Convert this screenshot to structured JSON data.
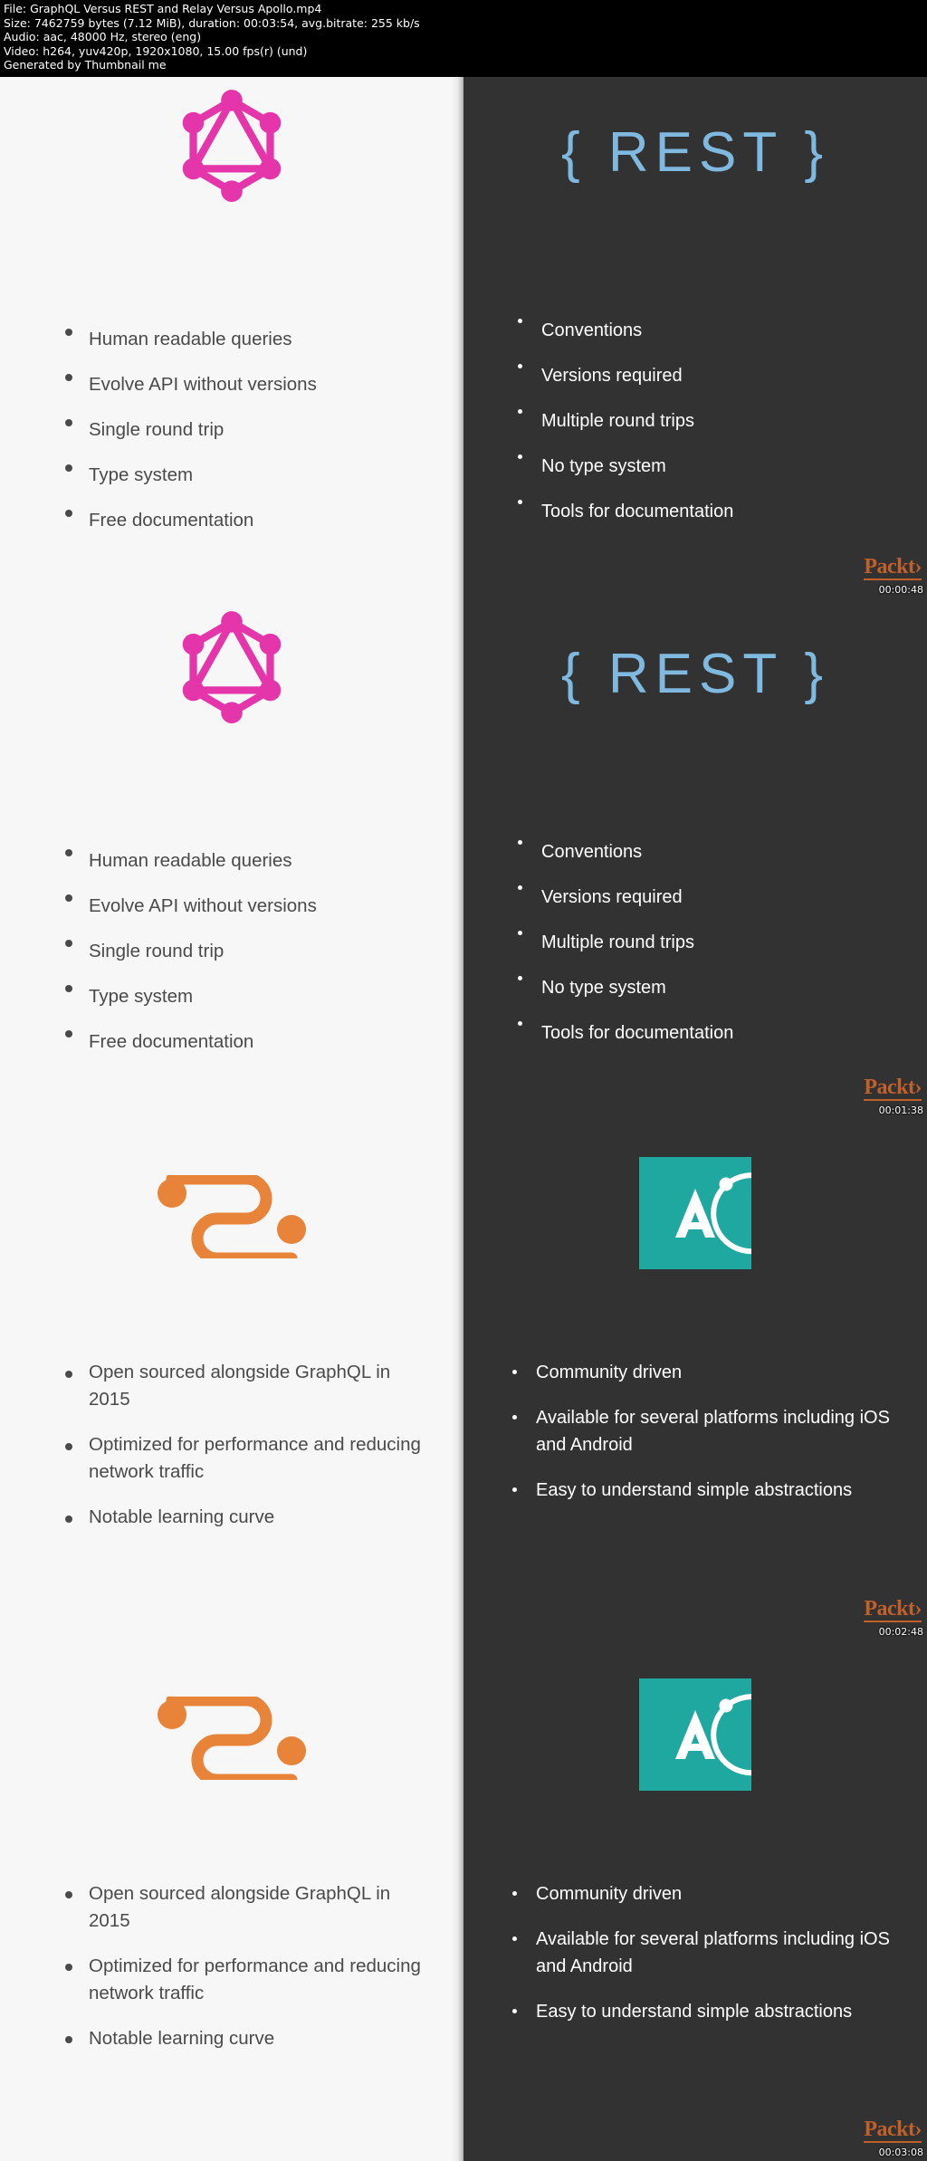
{
  "fileinfo": {
    "line1": "File: GraphQL Versus REST and Relay Versus Apollo.mp4",
    "line2": "Size: 7462759 bytes (7.12 MiB), duration: 00:03:54, avg.bitrate: 255 kb/s",
    "line3": "Audio: aac, 48000 Hz, stereo (eng)",
    "line4": "Video: h264, yuv420p, 1920x1080, 15.00 fps(r) (und)",
    "line5": "Generated by Thumbnail me"
  },
  "watermark": {
    "brand": "Packt›"
  },
  "colors": {
    "graphql_pink": "#e535ab",
    "rest_blue": "#7fb9e0",
    "relay_orange": "#e8833a",
    "apollo_teal": "#1fa8a0",
    "packt_orange": "#c8632a",
    "dark_bg": "#323232",
    "light_bg": "#f7f7f7"
  },
  "thumbnails": [
    {
      "timestamp": "00:00:48",
      "left": {
        "logo": "graphql-logo",
        "bullets": [
          "Human readable queries",
          "Evolve API without versions",
          "Single round trip",
          "Type system",
          "Free documentation"
        ]
      },
      "right": {
        "title": "{ REST }",
        "bullets": [
          "Conventions",
          "Versions required",
          "Multiple round trips",
          "No type system",
          "Tools for documentation"
        ]
      }
    },
    {
      "timestamp": "00:01:38",
      "left": {
        "logo": "graphql-logo",
        "bullets": [
          "Human readable queries",
          "Evolve API without versions",
          "Single round trip",
          "Type system",
          "Free documentation"
        ]
      },
      "right": {
        "title": "{ REST }",
        "bullets": [
          "Conventions",
          "Versions required",
          "Multiple round trips",
          "No type system",
          "Tools for documentation"
        ]
      }
    },
    {
      "timestamp": "00:02:48",
      "left": {
        "logo": "relay-logo",
        "bullets": [
          "Open sourced alongside GraphQL in 2015",
          "Optimized for performance and reducing network traffic",
          "Notable learning curve"
        ]
      },
      "right": {
        "logo": "apollo-logo",
        "bullets": [
          "Community driven",
          "Available for several platforms including iOS and Android",
          "Easy to understand simple abstractions"
        ]
      }
    },
    {
      "timestamp": "00:03:08",
      "left": {
        "logo": "relay-logo",
        "bullets": [
          "Open sourced alongside GraphQL in 2015",
          "Optimized for performance and reducing network traffic",
          "Notable learning curve"
        ]
      },
      "right": {
        "logo": "apollo-logo",
        "bullets": [
          "Community driven",
          "Available for several platforms including iOS and Android",
          "Easy to understand simple abstractions"
        ]
      }
    }
  ]
}
